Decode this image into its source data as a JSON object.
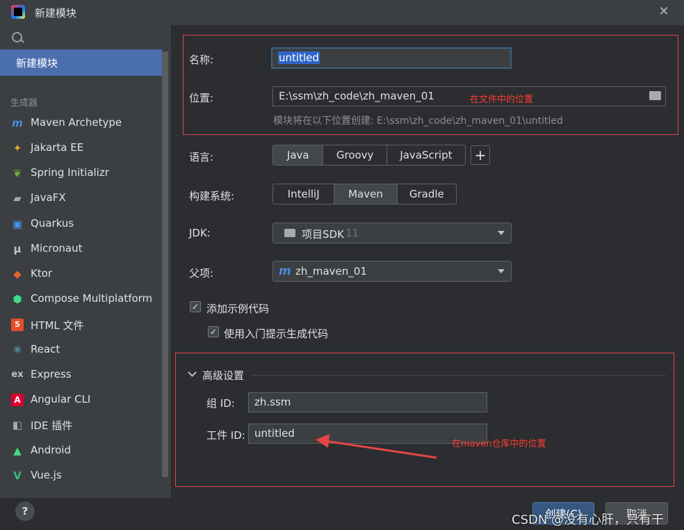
{
  "window": {
    "title": "新建模块"
  },
  "sidebar": {
    "selected": "新建模块",
    "group_label": "生成器",
    "items": [
      {
        "label": "Maven Archetype",
        "icon": "maven-icon"
      },
      {
        "label": "Jakarta EE",
        "icon": "jakarta-icon"
      },
      {
        "label": "Spring Initializr",
        "icon": "spring-icon"
      },
      {
        "label": "JavaFX",
        "icon": "javafx-icon"
      },
      {
        "label": "Quarkus",
        "icon": "quarkus-icon"
      },
      {
        "label": "Micronaut",
        "icon": "micronaut-icon"
      },
      {
        "label": "Ktor",
        "icon": "ktor-icon"
      },
      {
        "label": "Compose Multiplatform",
        "icon": "compose-icon"
      },
      {
        "label": "HTML 文件",
        "icon": "html5-icon"
      },
      {
        "label": "React",
        "icon": "react-icon"
      },
      {
        "label": "Express",
        "icon": "express-icon"
      },
      {
        "label": "Angular CLI",
        "icon": "angular-icon"
      },
      {
        "label": "IDE 插件",
        "icon": "ide-plugin-icon"
      },
      {
        "label": "Android",
        "icon": "android-icon"
      },
      {
        "label": "Vue.js",
        "icon": "vue-icon"
      }
    ]
  },
  "form": {
    "name_label": "名称:",
    "name_value": "untitled",
    "location_label": "位置:",
    "location_value": "E:\\ssm\\zh_code\\zh_maven_01",
    "location_hint": "模块将在以下位置创建: E:\\ssm\\zh_code\\zh_maven_01\\untitled",
    "language_label": "语言:",
    "languages": [
      "Java",
      "Groovy",
      "JavaScript"
    ],
    "language_selected": "Java",
    "build_label": "构建系统:",
    "build_systems": [
      "IntelliJ",
      "Maven",
      "Gradle"
    ],
    "build_selected": "Maven",
    "jdk_label": "JDK:",
    "jdk_value": "项目SDK",
    "jdk_version": "11",
    "parent_label": "父项:",
    "parent_value": "zh_maven_01",
    "add_sample_label": "添加示例代码",
    "onboarding_label": "使用入门提示生成代码",
    "advanced_label": "高级设置",
    "group_id_label": "组 ID:",
    "group_id_value": "zh.ssm",
    "artifact_id_label": "工件 ID:",
    "artifact_id_value": "untitled"
  },
  "annotations": {
    "location_note": "在文件中的位置",
    "maven_note": "在maven仓库中的位置"
  },
  "footer": {
    "create_label": "创建(C)",
    "cancel_label": "取消",
    "help_label": "?"
  },
  "watermark": "CSDN @没有心肝，只有干",
  "colors": {
    "accent": "#4b6eaf",
    "annotation": "#e64545",
    "link": "#4d8ae0"
  }
}
